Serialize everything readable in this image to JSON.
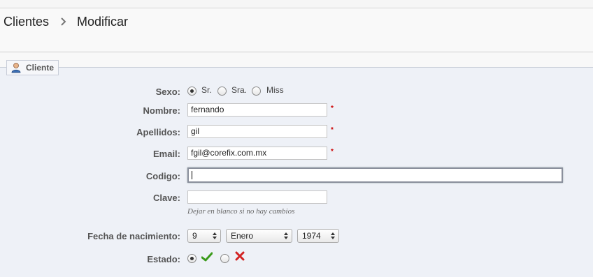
{
  "breadcrumb": {
    "parent": "Clientes",
    "current": "Modificar"
  },
  "fieldset": {
    "legend": "Cliente",
    "icon": "user-icon"
  },
  "sexo": {
    "label": "Sexo:",
    "options": [
      "Sr.",
      "Sra.",
      "Miss"
    ],
    "selected": "Sr."
  },
  "nombre": {
    "label": "Nombre:",
    "value": "fernando",
    "required": "*"
  },
  "apellidos": {
    "label": "Apellidos:",
    "value": "gil",
    "required": "*"
  },
  "email": {
    "label": "Email:",
    "value": "fgil@corefix.com.mx",
    "required": "*"
  },
  "codigo": {
    "label": "Codigo:",
    "value": ""
  },
  "clave": {
    "label": "Clave:",
    "value": "",
    "hint": "Dejar en blanco si no hay cambios"
  },
  "fecha": {
    "label": "Fecha de nacimiento:",
    "day": "9",
    "month": "Enero",
    "year": "1974"
  },
  "estado": {
    "label": "Estado:",
    "selected": "enabled",
    "enabled_icon": "check-icon",
    "disabled_icon": "cross-icon"
  },
  "colors": {
    "panel": "#eef1f7",
    "required": "#cc0000",
    "check": "#3a9a1a",
    "cross": "#d22222"
  }
}
